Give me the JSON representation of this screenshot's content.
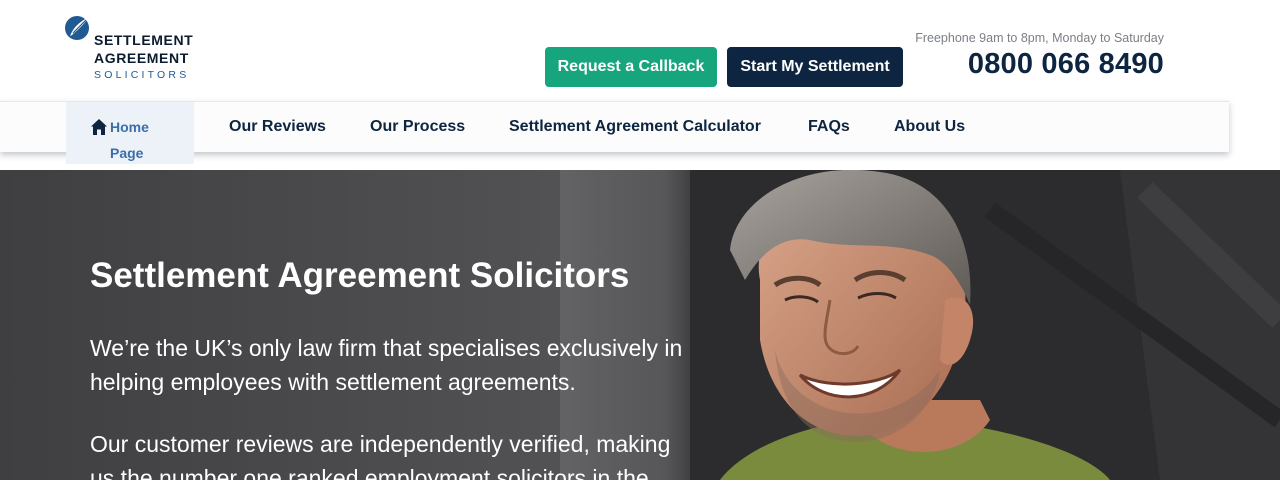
{
  "brand": {
    "line1": "SETTLEMENT",
    "line2": "AGREEMENT",
    "line3": "SOLICITORS",
    "accent_color": "#1f5a93"
  },
  "header": {
    "callback_button": "Request a Callback",
    "start_button": "Start My Settlement",
    "phone_caption": "Freephone 9am to 8pm, Monday to Saturday",
    "phone_number": "0800 066 8490",
    "callback_color": "#17a57d",
    "start_color": "#0d2540"
  },
  "nav": {
    "home": {
      "label": "Home Page",
      "icon": "home-icon"
    },
    "items": [
      "Our Reviews",
      "Our Process",
      "Settlement Agreement Calculator",
      "FAQs",
      "About Us"
    ]
  },
  "hero": {
    "title": "Settlement Agreement Solicitors",
    "paragraph1": "We’re the UK’s only law firm that specialises exclusively in helping employees with settlement agreements.",
    "paragraph2": "Our customer reviews are independently verified, making us the number one ranked employment solicitors in the"
  }
}
